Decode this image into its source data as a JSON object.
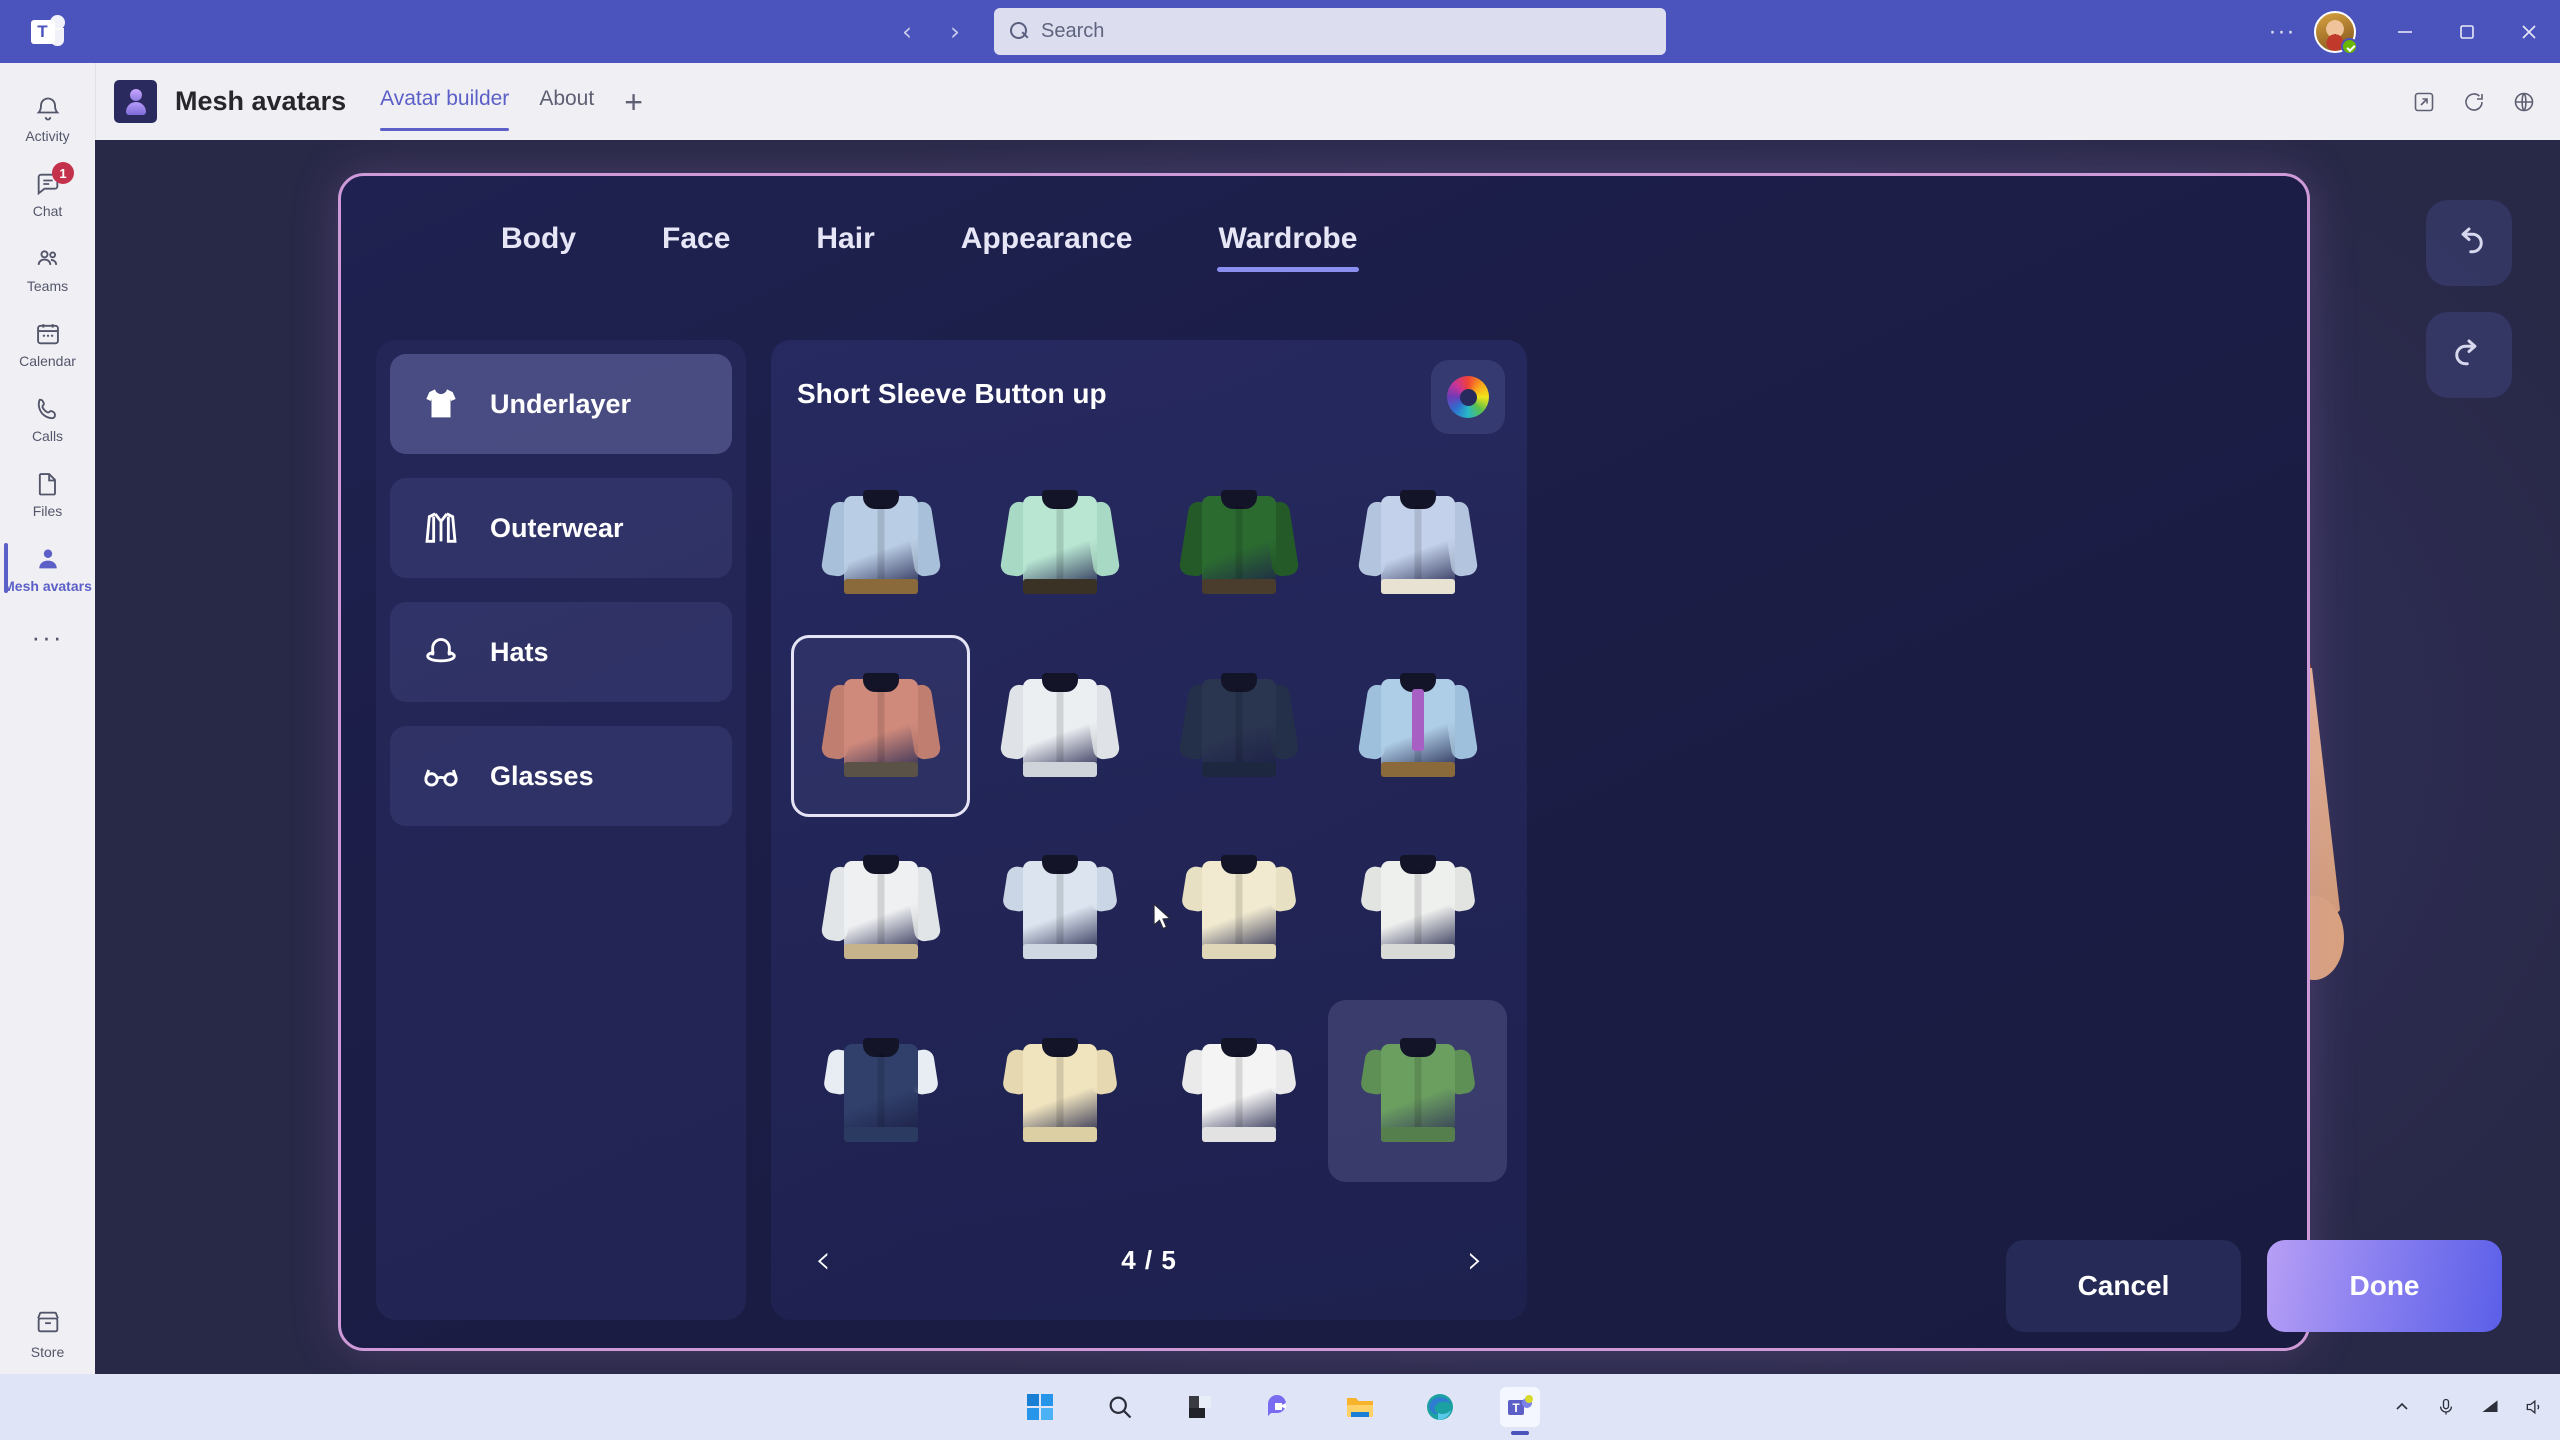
{
  "titlebar": {
    "app_logo": "teams-logo",
    "back_label": "‹",
    "forward_label": "›",
    "search_placeholder": "Search",
    "search_value": "",
    "more_label": "···",
    "presence": "available",
    "minimize_label": "minimize",
    "maximize_label": "maximize",
    "close_label": "close"
  },
  "rail": {
    "items": [
      {
        "label": "Activity",
        "icon": "bell-icon",
        "badge": "",
        "active": false
      },
      {
        "label": "Chat",
        "icon": "chat-icon",
        "badge": "1",
        "active": false
      },
      {
        "label": "Teams",
        "icon": "teams-icon",
        "badge": "",
        "active": false
      },
      {
        "label": "Calendar",
        "icon": "calendar-icon",
        "badge": "",
        "active": false
      },
      {
        "label": "Calls",
        "icon": "phone-icon",
        "badge": "",
        "active": false
      },
      {
        "label": "Files",
        "icon": "file-icon",
        "badge": "",
        "active": false
      },
      {
        "label": "Mesh avatars",
        "icon": "person-icon",
        "badge": "",
        "active": true
      }
    ],
    "more_label": "···",
    "store_label": "Store"
  },
  "app_header": {
    "title": "Mesh avatars",
    "tabs": [
      {
        "label": "Avatar builder",
        "active": true
      },
      {
        "label": "About",
        "active": false
      }
    ],
    "add_tab_label": "+",
    "right_icons": [
      "open-in-new-icon",
      "refresh-icon",
      "globe-icon"
    ]
  },
  "builder": {
    "tabs": [
      {
        "label": "Body",
        "active": false
      },
      {
        "label": "Face",
        "active": false
      },
      {
        "label": "Hair",
        "active": false
      },
      {
        "label": "Appearance",
        "active": false
      },
      {
        "label": "Wardrobe",
        "active": true
      }
    ],
    "categories": [
      {
        "label": "Underlayer",
        "icon": "tshirt-icon",
        "active": true
      },
      {
        "label": "Outerwear",
        "icon": "jacket-icon",
        "active": false
      },
      {
        "label": "Hats",
        "icon": "hat-icon",
        "active": false
      },
      {
        "label": "Glasses",
        "icon": "glasses-icon",
        "active": false
      }
    ],
    "item_panel": {
      "title": "Short Sleeve Button up",
      "color_button": "color-wheel-icon",
      "items": [
        {
          "name": "light-blue-dress-shirt",
          "body": "#b9cde4",
          "sleeve": "#a9c0da",
          "belt": "#8a6a3b",
          "state": ""
        },
        {
          "name": "mint-dotted-shirt",
          "body": "#b8e6d2",
          "sleeve": "#a8d9c4",
          "belt": "#3b3226",
          "state": ""
        },
        {
          "name": "dark-green-jacket",
          "body": "#2b6b30",
          "sleeve": "#235a28",
          "belt": "#4a3d2e",
          "state": ""
        },
        {
          "name": "blue-pinstripe-shirt",
          "body": "#c3d2ea",
          "sleeve": "#b3c4df",
          "belt": "#e8e2d2",
          "state": ""
        },
        {
          "name": "salmon-button-up",
          "body": "#d08a7c",
          "sleeve": "#c07e71",
          "belt": "#5a5246",
          "state": "selected"
        },
        {
          "name": "white-dress-shirt",
          "body": "#eceff2",
          "sleeve": "#dfe3e8",
          "belt": "#cfd4da",
          "state": ""
        },
        {
          "name": "navy-plaid-shirt",
          "body": "#2a3550",
          "sleeve": "#243049",
          "belt": "#1d2740",
          "state": ""
        },
        {
          "name": "blue-shirt-purple-tie",
          "body": "#aecde6",
          "sleeve": "#9fc0dc",
          "belt": "#8a6a3b",
          "state": ""
        },
        {
          "name": "white-suspender-shirt",
          "body": "#eef0f2",
          "sleeve": "#e2e5e8",
          "belt": "#c7b38b",
          "state": ""
        },
        {
          "name": "blue-striped-short-sleeve",
          "body": "#dbe4ef",
          "sleeve": "#cad6e5",
          "belt": "#cfd7e2",
          "state": ""
        },
        {
          "name": "cream-floral-dot-shirt",
          "body": "#f1ead0",
          "sleeve": "#e8e0c3",
          "belt": "#e0d7b8",
          "state": ""
        },
        {
          "name": "white-line-pattern-shirt",
          "body": "#eef0ee",
          "sleeve": "#e2e4e2",
          "belt": "#d8dad8",
          "state": ""
        },
        {
          "name": "navy-vertical-stripe-shirt",
          "body": "#30406b",
          "sleeve": "#e8ecf3",
          "belt": "#2a3a61",
          "state": ""
        },
        {
          "name": "cream-tropical-shirt",
          "body": "#f0e4bf",
          "sleeve": "#e6d9b1",
          "belt": "#ddcfa4",
          "state": ""
        },
        {
          "name": "multicolor-confetti-shirt",
          "body": "#f4f4f4",
          "sleeve": "#eaeaea",
          "belt": "#e2e2e2",
          "state": ""
        },
        {
          "name": "green-short-sleeve-shirt",
          "body": "#6b9f60",
          "sleeve": "#5e9055",
          "belt": "#567f4e",
          "state": "hovered"
        }
      ]
    },
    "pagination": {
      "prev_label": "‹",
      "page_label": "4 / 5",
      "next_label": "›",
      "current": 4,
      "total": 5
    },
    "undo_label": "undo-icon",
    "redo_label": "redo-icon",
    "cancel_label": "Cancel",
    "done_label": "Done"
  },
  "taskbar": {
    "items": [
      "windows-start-icon",
      "search-icon",
      "task-view-icon",
      "chat-icon",
      "file-explorer-icon",
      "edge-icon",
      "teams-icon"
    ],
    "tray": [
      "chevron-up-icon",
      "microphone-icon",
      "network-icon",
      "volume-icon"
    ]
  },
  "colors": {
    "teams_purple": "#4b53bc",
    "accent": "#5b5fc7",
    "dialog_border": "#cf9ad8",
    "badge_red": "#c4314b",
    "presence_green": "#6bb700"
  }
}
